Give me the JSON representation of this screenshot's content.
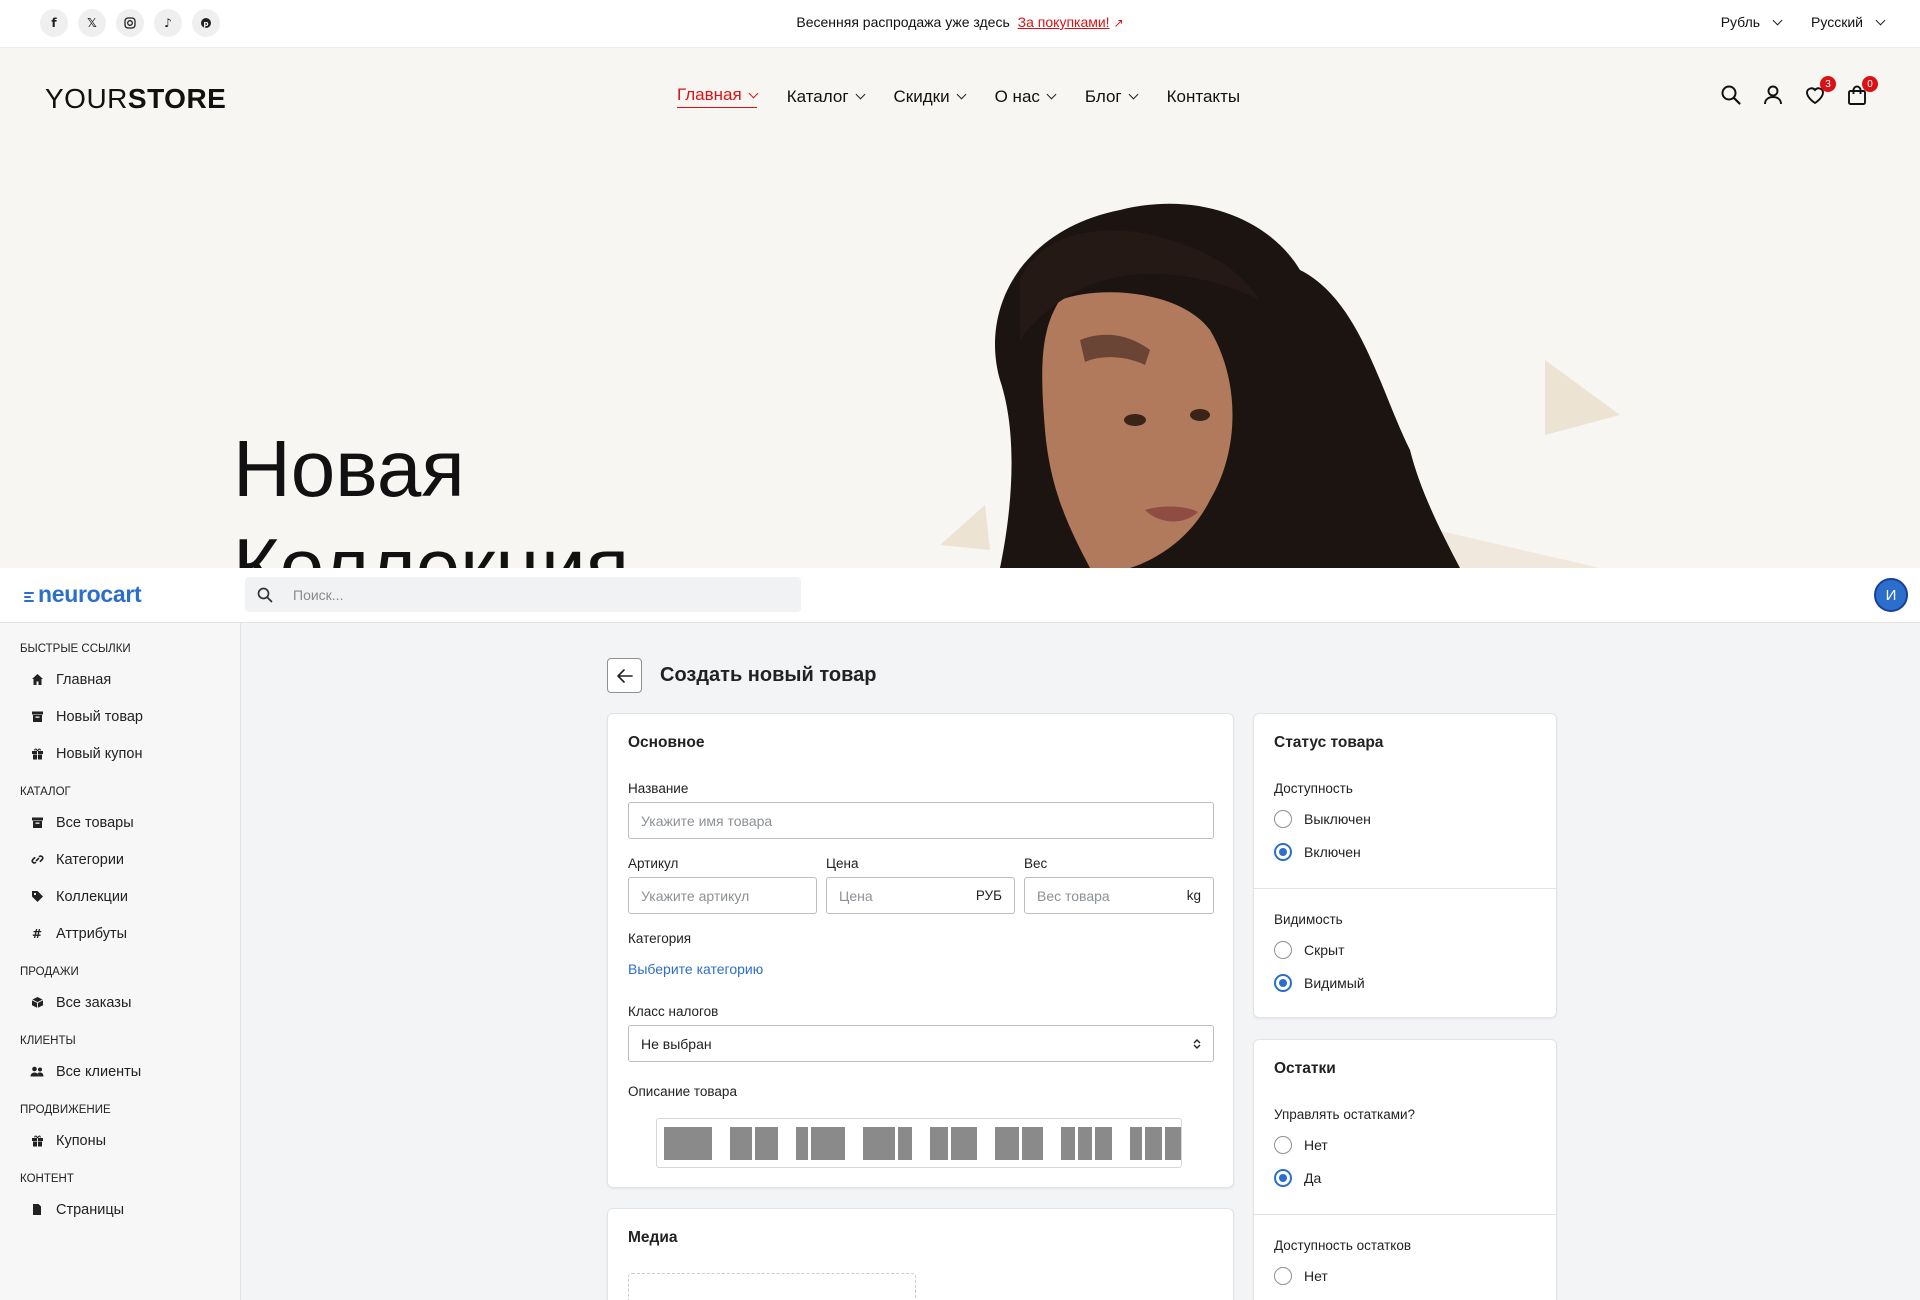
{
  "store": {
    "socials": [
      "f",
      "𝕏",
      "◎",
      "♪",
      "℗"
    ],
    "promo_text": "Весенняя распродажа уже здесь",
    "promo_link": "За покупками!",
    "promo_arrow": "↗",
    "currency": "Рубль",
    "language": "Русский",
    "logo_light": "YOUR",
    "logo_bold": "STORE",
    "nav": [
      {
        "label": "Главная"
      },
      {
        "label": "Каталог"
      },
      {
        "label": "Скидки"
      },
      {
        "label": "О нас"
      },
      {
        "label": "Блог"
      },
      {
        "label": "Контакты"
      }
    ],
    "wishlist_count": "3",
    "cart_count": "0",
    "hero_line1": "Новая",
    "hero_line2": "Коллекция",
    "accent_color": "#db1215"
  },
  "admin": {
    "logo": "neurocart",
    "search_placeholder": "Поиск...",
    "avatar_initial": "И",
    "sidebar": {
      "quick": "Быстрые ссылки",
      "quick_items": [
        "Главная",
        "Новый товар",
        "Новый купон"
      ],
      "catalog": "Каталог",
      "catalog_items": [
        "Все товары",
        "Категории",
        "Коллекции",
        "Аттрибуты"
      ],
      "sales": "Продажи",
      "sales_items": [
        "Все заказы"
      ],
      "customers": "Клиенты",
      "customers_items": [
        "Все клиенты"
      ],
      "promo": "Продвижение",
      "promo_items": [
        "Купоны"
      ],
      "content": "Контент",
      "content_items": [
        "Страницы"
      ]
    },
    "page_title": "Создать новый товар",
    "general": {
      "title": "Основное",
      "name_label": "Название",
      "name_placeholder": "Укажите имя товара",
      "sku_label": "Артикул",
      "sku_placeholder": "Укажите артикул",
      "price_label": "Цена",
      "price_placeholder": "Цена",
      "price_suffix": "РУБ",
      "weight_label": "Вес",
      "weight_placeholder": "Вес товара",
      "weight_suffix": "kg",
      "category_label": "Категория",
      "category_link": "Выберите категорию",
      "tax_label": "Класс налогов",
      "tax_value": "Не выбран",
      "desc_label": "Описание товара"
    },
    "media": {
      "title": "Медиа"
    },
    "status": {
      "title": "Статус товара",
      "availability_label": "Доступность",
      "availability_options": [
        "Выключен",
        "Включен"
      ],
      "availability_selected": "Включен",
      "visibility_label": "Видимость",
      "visibility_options": [
        "Скрыт",
        "Видимый"
      ],
      "visibility_selected": "Видимый"
    },
    "stock": {
      "title": "Остатки",
      "manage_label": "Управлять остатками?",
      "manage_options": [
        "Нет",
        "Да"
      ],
      "manage_selected": "Да",
      "availability_label": "Доступность остатков",
      "availability_options": [
        "Нет"
      ]
    },
    "accent_color": "#2c6ecb"
  }
}
